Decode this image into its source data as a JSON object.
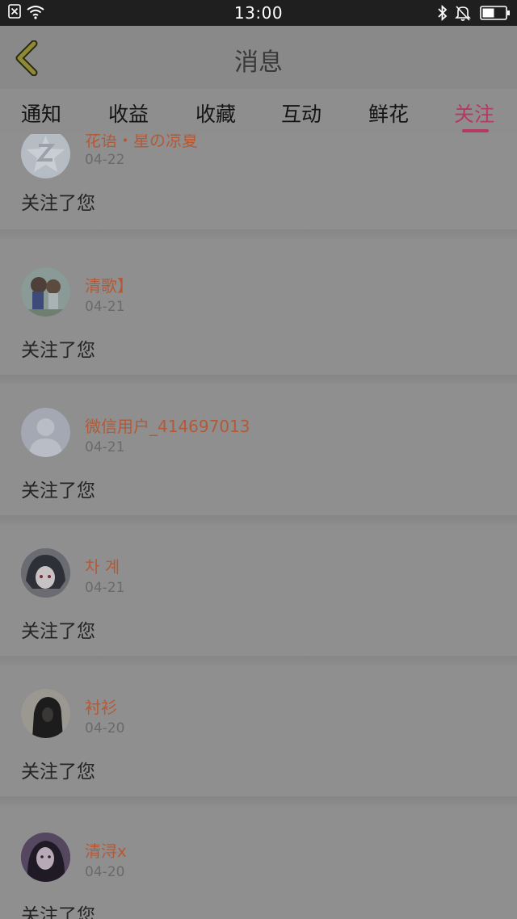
{
  "status_bar": {
    "time": "13:00"
  },
  "header": {
    "title": "消息"
  },
  "tabs": [
    {
      "label": "通知",
      "active": false
    },
    {
      "label": "收益",
      "active": false
    },
    {
      "label": "收藏",
      "active": false
    },
    {
      "label": "互动",
      "active": false
    },
    {
      "label": "鲜花",
      "active": false
    },
    {
      "label": "关注",
      "active": true
    }
  ],
  "colors": {
    "accent": "#b53a63",
    "username": "#b25a38"
  },
  "notifications": [
    {
      "username": "花语・星の凉夏",
      "date": "04-22",
      "message": "关注了您",
      "avatar": "qzone-default-avatar"
    },
    {
      "username": "清歌】",
      "date": "04-21",
      "message": "关注了您",
      "avatar": "anime-girls-avatar"
    },
    {
      "username": "微信用户_414697013",
      "date": "04-21",
      "message": "关注了您",
      "avatar": "default-person-avatar"
    },
    {
      "username": "차 계",
      "date": "04-21",
      "message": "关注了您",
      "avatar": "anime-dark-avatar"
    },
    {
      "username": "衬衫",
      "date": "04-20",
      "message": "关注了您",
      "avatar": "hooded-figure-avatar"
    },
    {
      "username": "清浔x",
      "date": "04-20",
      "message": "关注了您",
      "avatar": "portrait-girl-avatar"
    }
  ]
}
